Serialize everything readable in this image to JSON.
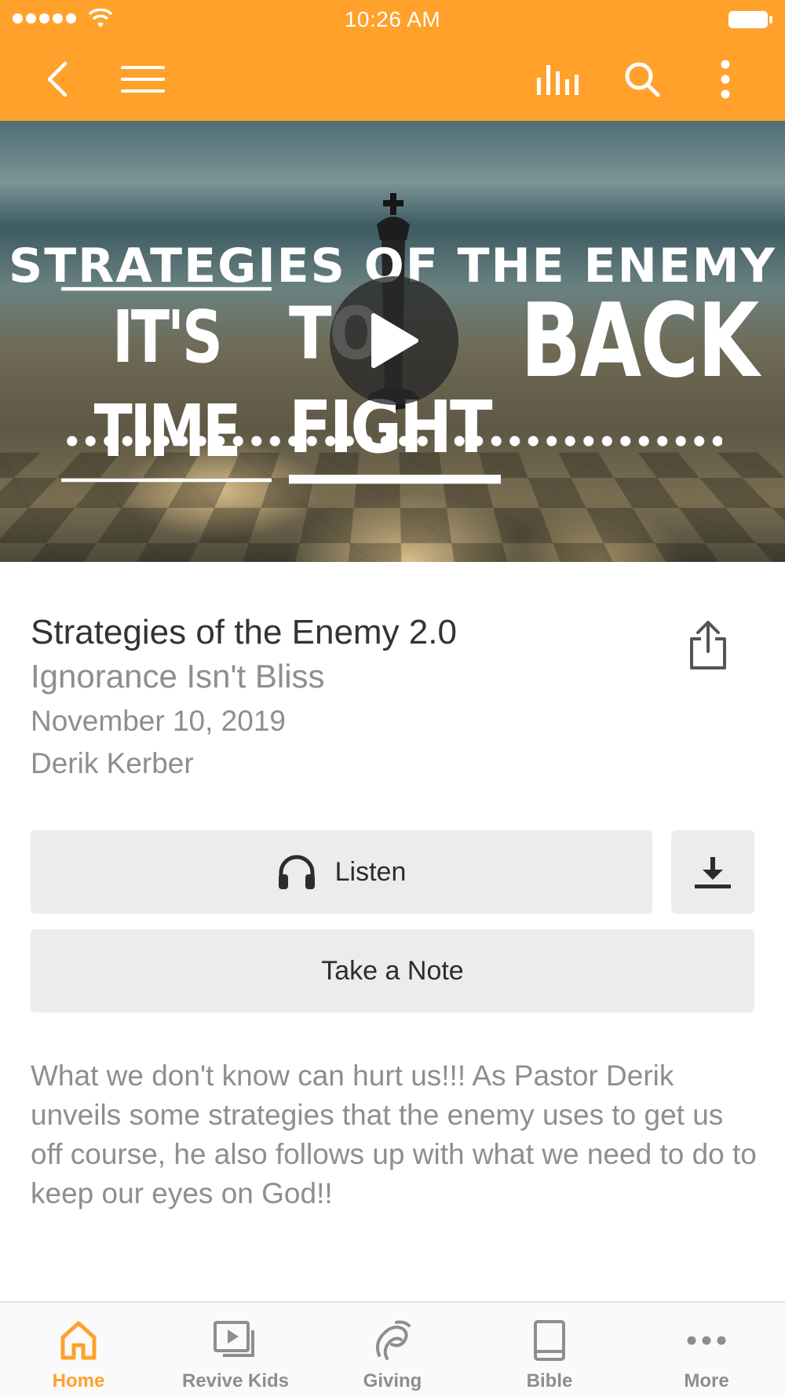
{
  "status_bar": {
    "time": "10:26 AM"
  },
  "colors": {
    "accent": "#FFA12B",
    "tab_inactive": "#8e8e8e",
    "button_bg": "#ECECEE"
  },
  "nav": {
    "icons": [
      "back-icon",
      "menu-icon",
      "stats-icon",
      "search-icon",
      "more-vertical-icon"
    ]
  },
  "hero": {
    "line1": "STRATEGIES OF THE ENEMY",
    "line2a": "IT'S TIME",
    "line2b": "TO FIGHT",
    "line2c": "BACK"
  },
  "sermon": {
    "title": "Strategies of the Enemy 2.0",
    "subtitle": "Ignorance Isn't Bliss",
    "date": "November 10, 2019",
    "speaker": "Derik Kerber",
    "description": "What we don't know can hurt us!!! As Pastor Derik unveils some strategies that the enemy uses to get us off course, he also follows up with what we need to do to keep our eyes on God!!"
  },
  "actions": {
    "listen_label": "Listen",
    "note_label": "Take a Note"
  },
  "tabs": [
    {
      "label": "Home",
      "icon": "home-icon",
      "active": true
    },
    {
      "label": "Revive Kids",
      "icon": "video-library-icon",
      "active": false
    },
    {
      "label": "Giving",
      "icon": "giving-icon",
      "active": false
    },
    {
      "label": "Bible",
      "icon": "book-icon",
      "active": false
    },
    {
      "label": "More",
      "icon": "more-horizontal-icon",
      "active": false
    }
  ]
}
